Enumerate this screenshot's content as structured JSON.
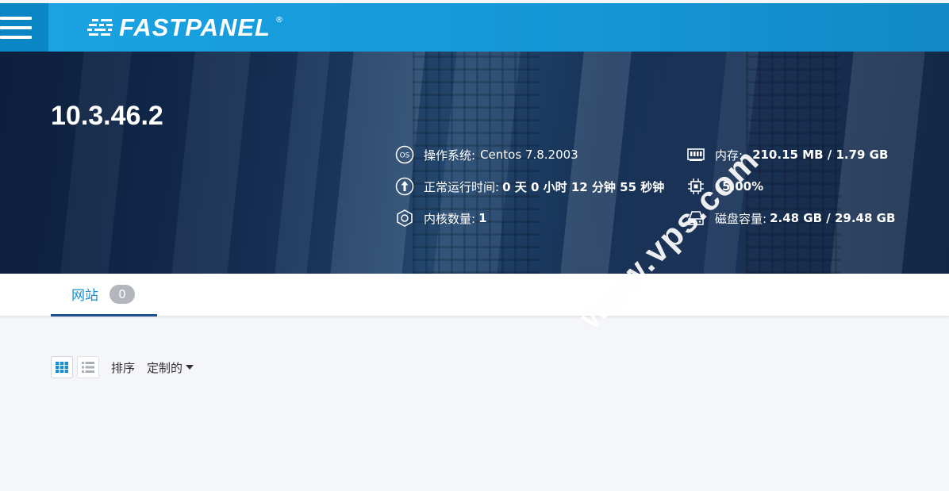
{
  "header": {
    "brand": "FASTPANEL",
    "brand_mark": "®"
  },
  "server": {
    "ip": "10.3.46.2"
  },
  "stats": {
    "os_label": "操作系统:",
    "os_value": "Centos 7.8.2003",
    "uptime_label": "正常运行时间:",
    "uptime_value": "0 天 0 小时 12 分钟 55 秒钟",
    "cores_label": "内核数量:",
    "cores_value": "1",
    "memory_label": "内存:",
    "memory_value": "210.15 MB / 1.79 GB",
    "cpu_label": ":",
    "cpu_value": "5.00%",
    "disk_label": "磁盘容量:",
    "disk_value": "2.48 GB / 29.48 GB"
  },
  "tabs": [
    {
      "label": "网站",
      "count": "0"
    }
  ],
  "toolbar": {
    "sort_label": "排序",
    "sort_value": "定制的"
  },
  "watermark": "www.vps.com",
  "colors": {
    "topbar": "#1597d6",
    "accent": "#1a8fd0",
    "tab_underline": "#1b4f8f",
    "badge": "#b3b7bd"
  },
  "icons": [
    "menu-icon",
    "fastpanel-logo-icon",
    "os-icon",
    "uptime-icon",
    "cores-icon",
    "memory-icon",
    "cpu-icon",
    "disk-icon",
    "grid-view-icon",
    "list-view-icon",
    "caret-down-icon"
  ]
}
